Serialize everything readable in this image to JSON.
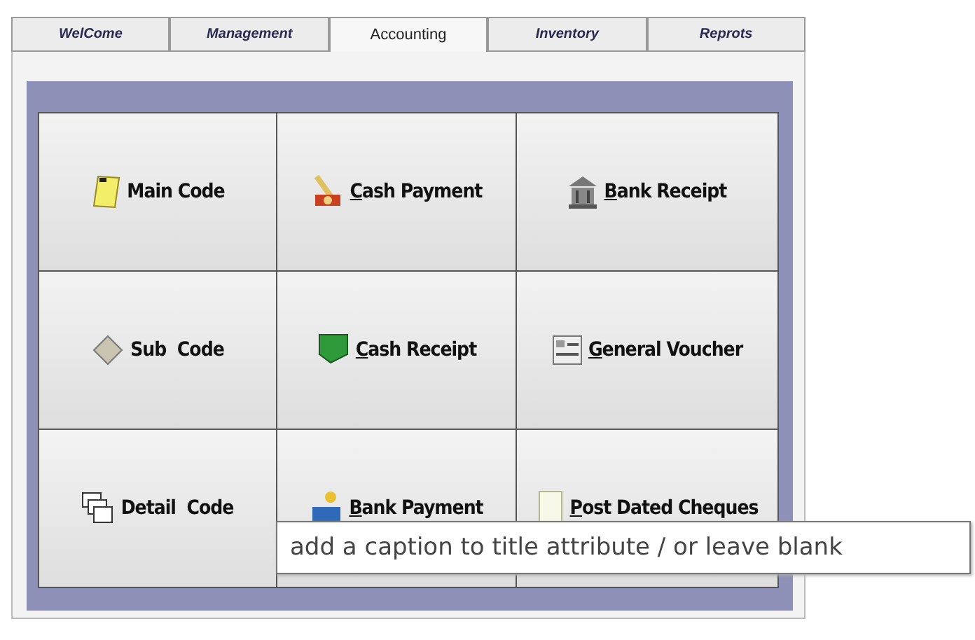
{
  "tabs": [
    {
      "label": "WelCome",
      "selected": false
    },
    {
      "label": "Management",
      "selected": false
    },
    {
      "label": "Accounting",
      "selected": true
    },
    {
      "label": "Inventory",
      "selected": false
    },
    {
      "label": "Reprots",
      "selected": false
    }
  ],
  "buttons": [
    {
      "label": "Main Code",
      "mnemonic": false
    },
    {
      "label": "Cash Payment",
      "mnemonic": true
    },
    {
      "label": "Bank Receipt",
      "mnemonic": true
    },
    {
      "label": "Sub  Code",
      "mnemonic": false
    },
    {
      "label": "Cash Receipt",
      "mnemonic": true
    },
    {
      "label": "General Voucher",
      "mnemonic": true
    },
    {
      "label": "Detail  Code",
      "mnemonic": false
    },
    {
      "label": "Bank Payment",
      "mnemonic": true
    },
    {
      "label": "Post Dated Cheques",
      "mnemonic": true
    }
  ],
  "tooltip": "add a caption to title attribute / or leave blank"
}
